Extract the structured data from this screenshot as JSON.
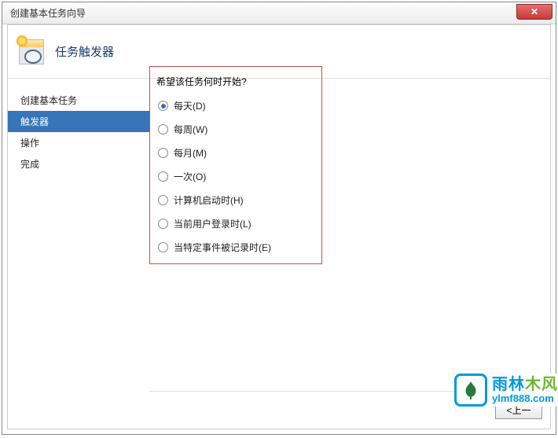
{
  "window": {
    "title": "创建基本任务向导",
    "close_label": "✕"
  },
  "header": {
    "title": "任务触发器"
  },
  "sidebar": {
    "items": [
      {
        "label": "创建基本任务",
        "selected": false
      },
      {
        "label": "触发器",
        "selected": true
      },
      {
        "label": "操作",
        "selected": false
      },
      {
        "label": "完成",
        "selected": false
      }
    ]
  },
  "main": {
    "prompt": "希望该任务何时开始?",
    "options": [
      {
        "label": "每天(D)",
        "checked": true
      },
      {
        "label": "每周(W)",
        "checked": false
      },
      {
        "label": "每月(M)",
        "checked": false
      },
      {
        "label": "一次(O)",
        "checked": false
      },
      {
        "label": "计算机启动时(H)",
        "checked": false
      },
      {
        "label": "当前用户登录时(L)",
        "checked": false
      },
      {
        "label": "当特定事件被记录时(E)",
        "checked": false
      }
    ]
  },
  "footer": {
    "back": "<上一"
  },
  "watermark": {
    "cn1": "雨林",
    "cn2": "木风",
    "url": "ylmf888.com"
  }
}
